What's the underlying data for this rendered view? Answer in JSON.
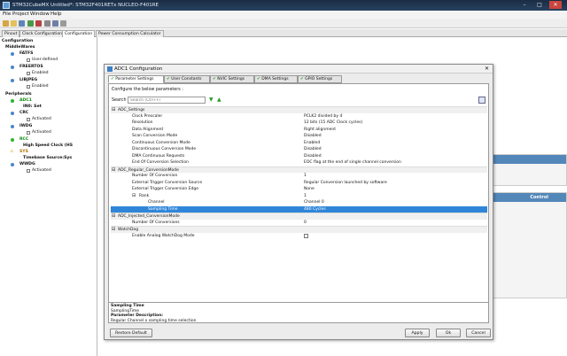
{
  "window": {
    "title": "STM32CubeMX Untitled*: STM32F401RETx NUCLEO-F401RE",
    "controls": [
      "–",
      "□",
      "✕"
    ]
  },
  "menu": [
    "File",
    "Project",
    "Window",
    "Help"
  ],
  "main_tabs": [
    "Pinout",
    "Clock Configuration",
    "Configuration",
    "Power Consumption Calculator"
  ],
  "tree": {
    "root": "Configuration",
    "sections": [
      {
        "label": "MiddleWares"
      },
      {
        "label": "FATFS"
      },
      {
        "label": "User-defined"
      },
      {
        "label": "FREERTOS"
      },
      {
        "label": "Enabled"
      },
      {
        "label": "LIBJPEG"
      },
      {
        "label": "Enabled"
      },
      {
        "label": "Peripherals"
      },
      {
        "label": "ADC1"
      },
      {
        "label": "IN0: Set"
      },
      {
        "label": "CRC"
      },
      {
        "label": "Activated"
      },
      {
        "label": "IWDG"
      },
      {
        "label": "Activated"
      },
      {
        "label": "RCC"
      },
      {
        "label": "High Speed Clock (HS"
      },
      {
        "label": "SYS"
      },
      {
        "label": "Timebase Source:Sys"
      },
      {
        "label": "WWDG"
      },
      {
        "label": "Activated"
      }
    ]
  },
  "bg_panel": {
    "header": "Control"
  },
  "dialog": {
    "title": "ADC1 Configuration",
    "tabs": [
      "Parameter Settings",
      "User Constants",
      "NVIC Settings",
      "DMA Settings",
      "GPIO Settings"
    ],
    "configure_label": "Configure the below parameters :",
    "search_label": "Search",
    "search_placeholder": "Search (Ctrl+F)",
    "rows": [
      {
        "name": "ADC_Settings",
        "value": "",
        "group": true
      },
      {
        "name": "Clock Prescaler",
        "value": "PCLK2 divided by 4"
      },
      {
        "name": "Resolution",
        "value": "12 bits (15 ADC Clock cycles)"
      },
      {
        "name": "Data Alignment",
        "value": "Right alignment"
      },
      {
        "name": "Scan Conversion Mode",
        "value": "Disabled"
      },
      {
        "name": "Continuous Conversion Mode",
        "value": "Enabled"
      },
      {
        "name": "Discontinuous Conversion Mode",
        "value": "Disabled"
      },
      {
        "name": "DMA Continuous Requests",
        "value": "Disabled"
      },
      {
        "name": "End Of Conversion Selection",
        "value": "EOC flag at the end of single channel conversion"
      },
      {
        "name": "ADC_Regular_ConversionMode",
        "value": "",
        "group": true
      },
      {
        "name": "Number Of Conversion",
        "value": "1"
      },
      {
        "name": "External Trigger Conversion Source",
        "value": "Regular Conversion launched by software"
      },
      {
        "name": "External Trigger Conversion Edge",
        "value": "None"
      },
      {
        "name": "Rank",
        "value": "1"
      },
      {
        "name": "Channel",
        "value": "Channel 0"
      },
      {
        "name": "Sampling Time",
        "value": "480 Cycles",
        "selected": true
      },
      {
        "name": "ADC_Injected_ConversionMode",
        "value": "",
        "group": true
      },
      {
        "name": "Number Of Conversions",
        "value": "0"
      },
      {
        "name": "WatchDog",
        "value": "",
        "group": true
      },
      {
        "name": "Enable Analog WatchDog Mode",
        "value": "",
        "checkbox": true
      }
    ],
    "desc": {
      "title": "Sampling Time",
      "name": "SamplingTime",
      "param_label": "Parameter Description:",
      "text": "Regular Channel x sampling time selection"
    },
    "buttons": {
      "restore": "Restore Default",
      "apply": "Apply",
      "ok": "Ok",
      "cancel": "Cancel"
    }
  },
  "colors": {
    "titlebar": "#1b2c44",
    "selection": "#2f86d9",
    "panel_header": "#5387b9",
    "green": "#0a8a0a"
  }
}
